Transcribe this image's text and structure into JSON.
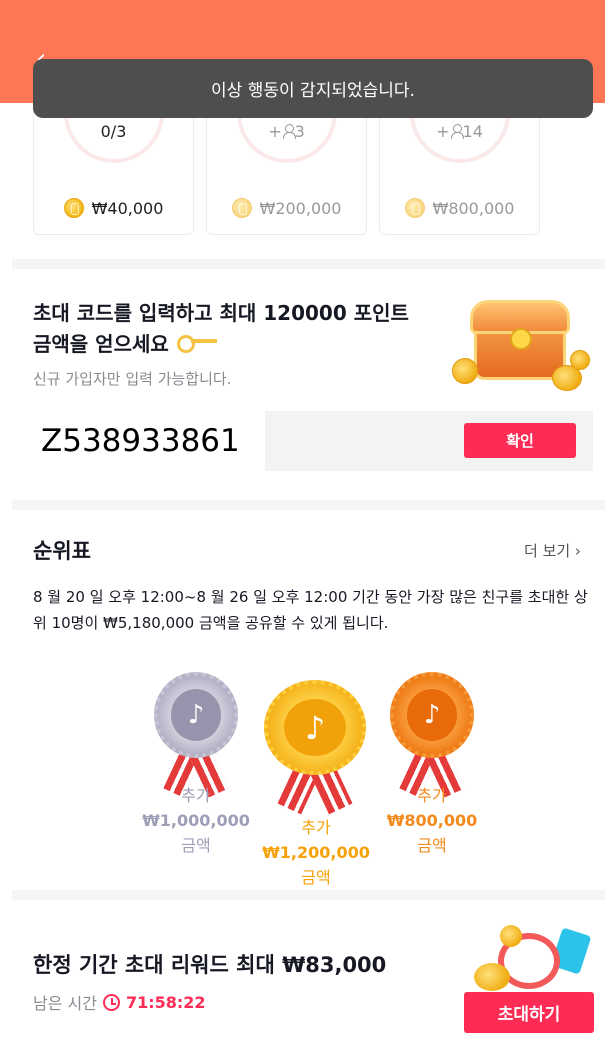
{
  "toast": {
    "message": "이상 행동이 감지되었습니다."
  },
  "milestones": [
    {
      "count": "0/3",
      "reward": "₩40,000"
    },
    {
      "count": "+",
      "people": "3",
      "reward": "₩200,000"
    },
    {
      "count": "+",
      "people": "14",
      "reward": "₩800,000"
    }
  ],
  "invite": {
    "title": "초대 코드를 입력하고 최대 120000 포인트 금액을 얻으세요",
    "subtitle": "신규 가입자만 입력 가능합니다.",
    "code_value": "Z538933861",
    "confirm_label": "확인"
  },
  "leaderboard": {
    "title": "순위표",
    "more_label": "더 보기 ›",
    "description": "8 월 20 일 오후 12:00~8 월 26 일 오후 12:00 기간 동안 가장 많은 친구를 초대한 상위 10명이 ₩5,180,000 금액을 공유할 수 있게 됩니다.",
    "prizes": [
      {
        "prefix": "추가",
        "amount": "₩1,000,000",
        "suffix": "금액",
        "color": "#9f9eb8"
      },
      {
        "prefix": "추가",
        "amount": "₩1,200,000",
        "suffix": "금액",
        "color": "#f5a208"
      },
      {
        "prefix": "추가",
        "amount": "₩800,000",
        "suffix": "금액",
        "color": "#f28a1e"
      }
    ]
  },
  "limited": {
    "title": "한정 기간 초대 리워드 최대 ₩83,000",
    "remaining_label": "남은 시간",
    "countdown": "71:58:22",
    "invite_label": "초대하기"
  },
  "colors": {
    "header": "#fe7653",
    "primary": "#fe2c55",
    "toast": "#4e4e4e"
  },
  "icons": {
    "back": "back-arrow-icon",
    "coin": "coin-icon",
    "person": "person-icon",
    "key": "key-icon",
    "clock": "clock-icon",
    "medal": "tiktok-note-icon"
  }
}
